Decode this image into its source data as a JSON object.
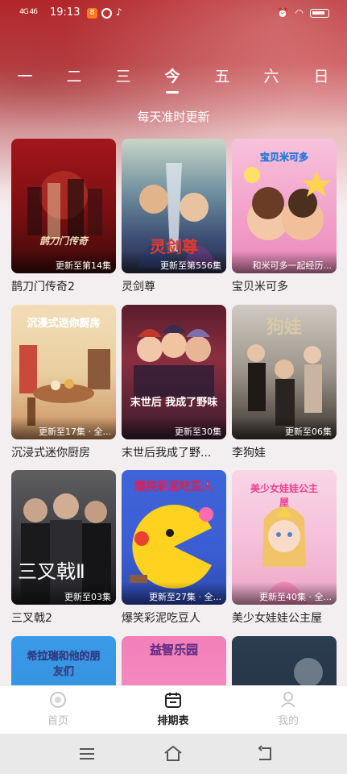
{
  "status": {
    "signal": "4G 46",
    "time": "19:13",
    "battery": "100"
  },
  "days": [
    {
      "label": "一",
      "active": false
    },
    {
      "label": "二",
      "active": false
    },
    {
      "label": "三",
      "active": false
    },
    {
      "label": "今",
      "active": true
    },
    {
      "label": "五",
      "active": false
    },
    {
      "label": "六",
      "active": false
    },
    {
      "label": "日",
      "active": false
    }
  ],
  "subtitle": "每天准时更新",
  "cards": [
    {
      "title": "鹊刀门传奇2",
      "caption": "更新至第14集",
      "art_text": "鹊刀门传奇"
    },
    {
      "title": "灵剑尊",
      "caption": "更新至第556集",
      "art_text": "灵剑尊"
    },
    {
      "title": "宝贝米可多",
      "caption": "和米可多一起经历...",
      "art_text": "宝贝米可多"
    },
    {
      "title": "沉浸式迷你厨房",
      "caption": "更新至17集 · 全...",
      "art_text": "沉浸式迷你厨房"
    },
    {
      "title": "末世后我成了野...",
      "caption": "更新至30集",
      "art_text": "末世后 我成了野味"
    },
    {
      "title": "李狗娃",
      "caption": "更新至06集",
      "art_text": "狗娃"
    },
    {
      "title": "三叉戟2",
      "caption": "更新至03集",
      "art_text": "三叉戟Ⅱ"
    },
    {
      "title": "爆笑彩泥吃豆人",
      "caption": "更新至27集 · 全...",
      "art_text": "爆笑彩泥吃豆人"
    },
    {
      "title": "美少女娃娃公主屋",
      "caption": "更新至40集 · 全...",
      "art_text": "美少女娃娃公主屋"
    },
    {
      "title": "",
      "caption": "",
      "art_text": "希拉瑞和他的朋友们"
    },
    {
      "title": "",
      "caption": "",
      "art_text": "益智乐园"
    },
    {
      "title": "",
      "caption": "",
      "art_text": ""
    }
  ],
  "tabs": [
    {
      "label": "首页",
      "icon": "home-icon",
      "active": false
    },
    {
      "label": "排期表",
      "icon": "calendar-icon",
      "active": true
    },
    {
      "label": "我的",
      "icon": "profile-icon",
      "active": false
    }
  ],
  "colors": {
    "accent": "#c3282d",
    "tab_active": "#222222",
    "tab_inactive": "#bbbbbb"
  }
}
